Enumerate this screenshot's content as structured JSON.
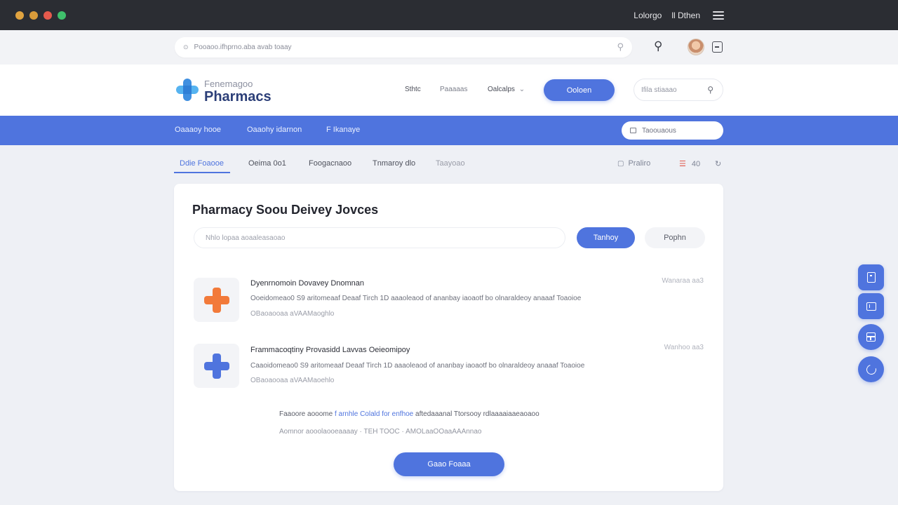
{
  "colors": {
    "accent": "#4f74de",
    "titlebar": "#2b2d33",
    "traffic": [
      "#e0a340",
      "#d99b3a",
      "#e55a4d",
      "#3fbf6b"
    ]
  },
  "titlebar": {
    "user_label": "Lolorgo",
    "account_label": "ll Dthen",
    "menu_icon": "hamburger-icon"
  },
  "browser": {
    "address": "Pooaoo.ifhprno.aba avab toaay",
    "search_icon": "search-icon",
    "extension_icon": "extension-icon"
  },
  "header": {
    "brand_small": "Fenemagoo",
    "brand_name": "Pharmacs",
    "nav": [
      "Sthtc",
      "Paaaaas",
      "Oalcalps"
    ],
    "nav_caret": "⌄",
    "cta_label": "Ooloen",
    "search_placeholder": "Ifila stiaaao"
  },
  "category_bar": {
    "links": [
      "Oaaaoy hooe",
      "Oaaohy idarnon",
      "F Ikanaye"
    ],
    "search_placeholder": "Taoouaous"
  },
  "tabs": {
    "items": [
      "Ddie Foaooe",
      "Oeima 0o1",
      "Foogacnaoo",
      "Tnmaroy dlo",
      "Taayoao"
    ],
    "print_label": "Praliro",
    "count_label": "40",
    "share_icon": "share-icon"
  },
  "card": {
    "title": "Pharmacy Soou Deivey Jovces",
    "input_placeholder": "Nhlo lopaa aoaaleasaoao",
    "primary_label": "Tanhoy",
    "secondary_label": "Pophn",
    "items": [
      {
        "title": "Dyenrnomoin Dovavey Dnomnan",
        "desc": "Ooeidomeao0 S9 aritomeaaf Deaaf Tirch 1D aaaoleaod of ananbay iaoaotf bo olnaraldeoy anaaaf Toaoioe",
        "desc2": "OBaoaooaa aVAAMaoghlo",
        "meta": "Wanaraa aa3",
        "icon_color": "#f27a3a"
      },
      {
        "title": "Frammacoqtiny Provasidd Lavvas Oeieomipoy",
        "desc": "Caaoidomeao0 S9 aritomeaaf Deaaf Tirch 1D aaaoleaod of ananbay iaoaotf bo olnaraldeoy anaaaf Toaoioe",
        "desc2": "OBaoaooaa aVAAMaoehlo",
        "meta": "Wanhoo aa3",
        "icon_color": "#4f74de"
      }
    ],
    "note_prefix": "Faaoore aooome ",
    "note_highlight": "f arnhle Colald for enfhoe",
    "note_suffix": " aftedaaanal Ttorsooy rdlaaaaiaaeaoaoo",
    "note2": "Aomnor aooolaooeaaaay · TEH TOOC · AMOLaaOOaaAAAnnao",
    "button_label": "Gaao Foaaa"
  },
  "float_toolbar": [
    "document-icon",
    "panel-icon",
    "grid-icon",
    "sync-icon"
  ]
}
